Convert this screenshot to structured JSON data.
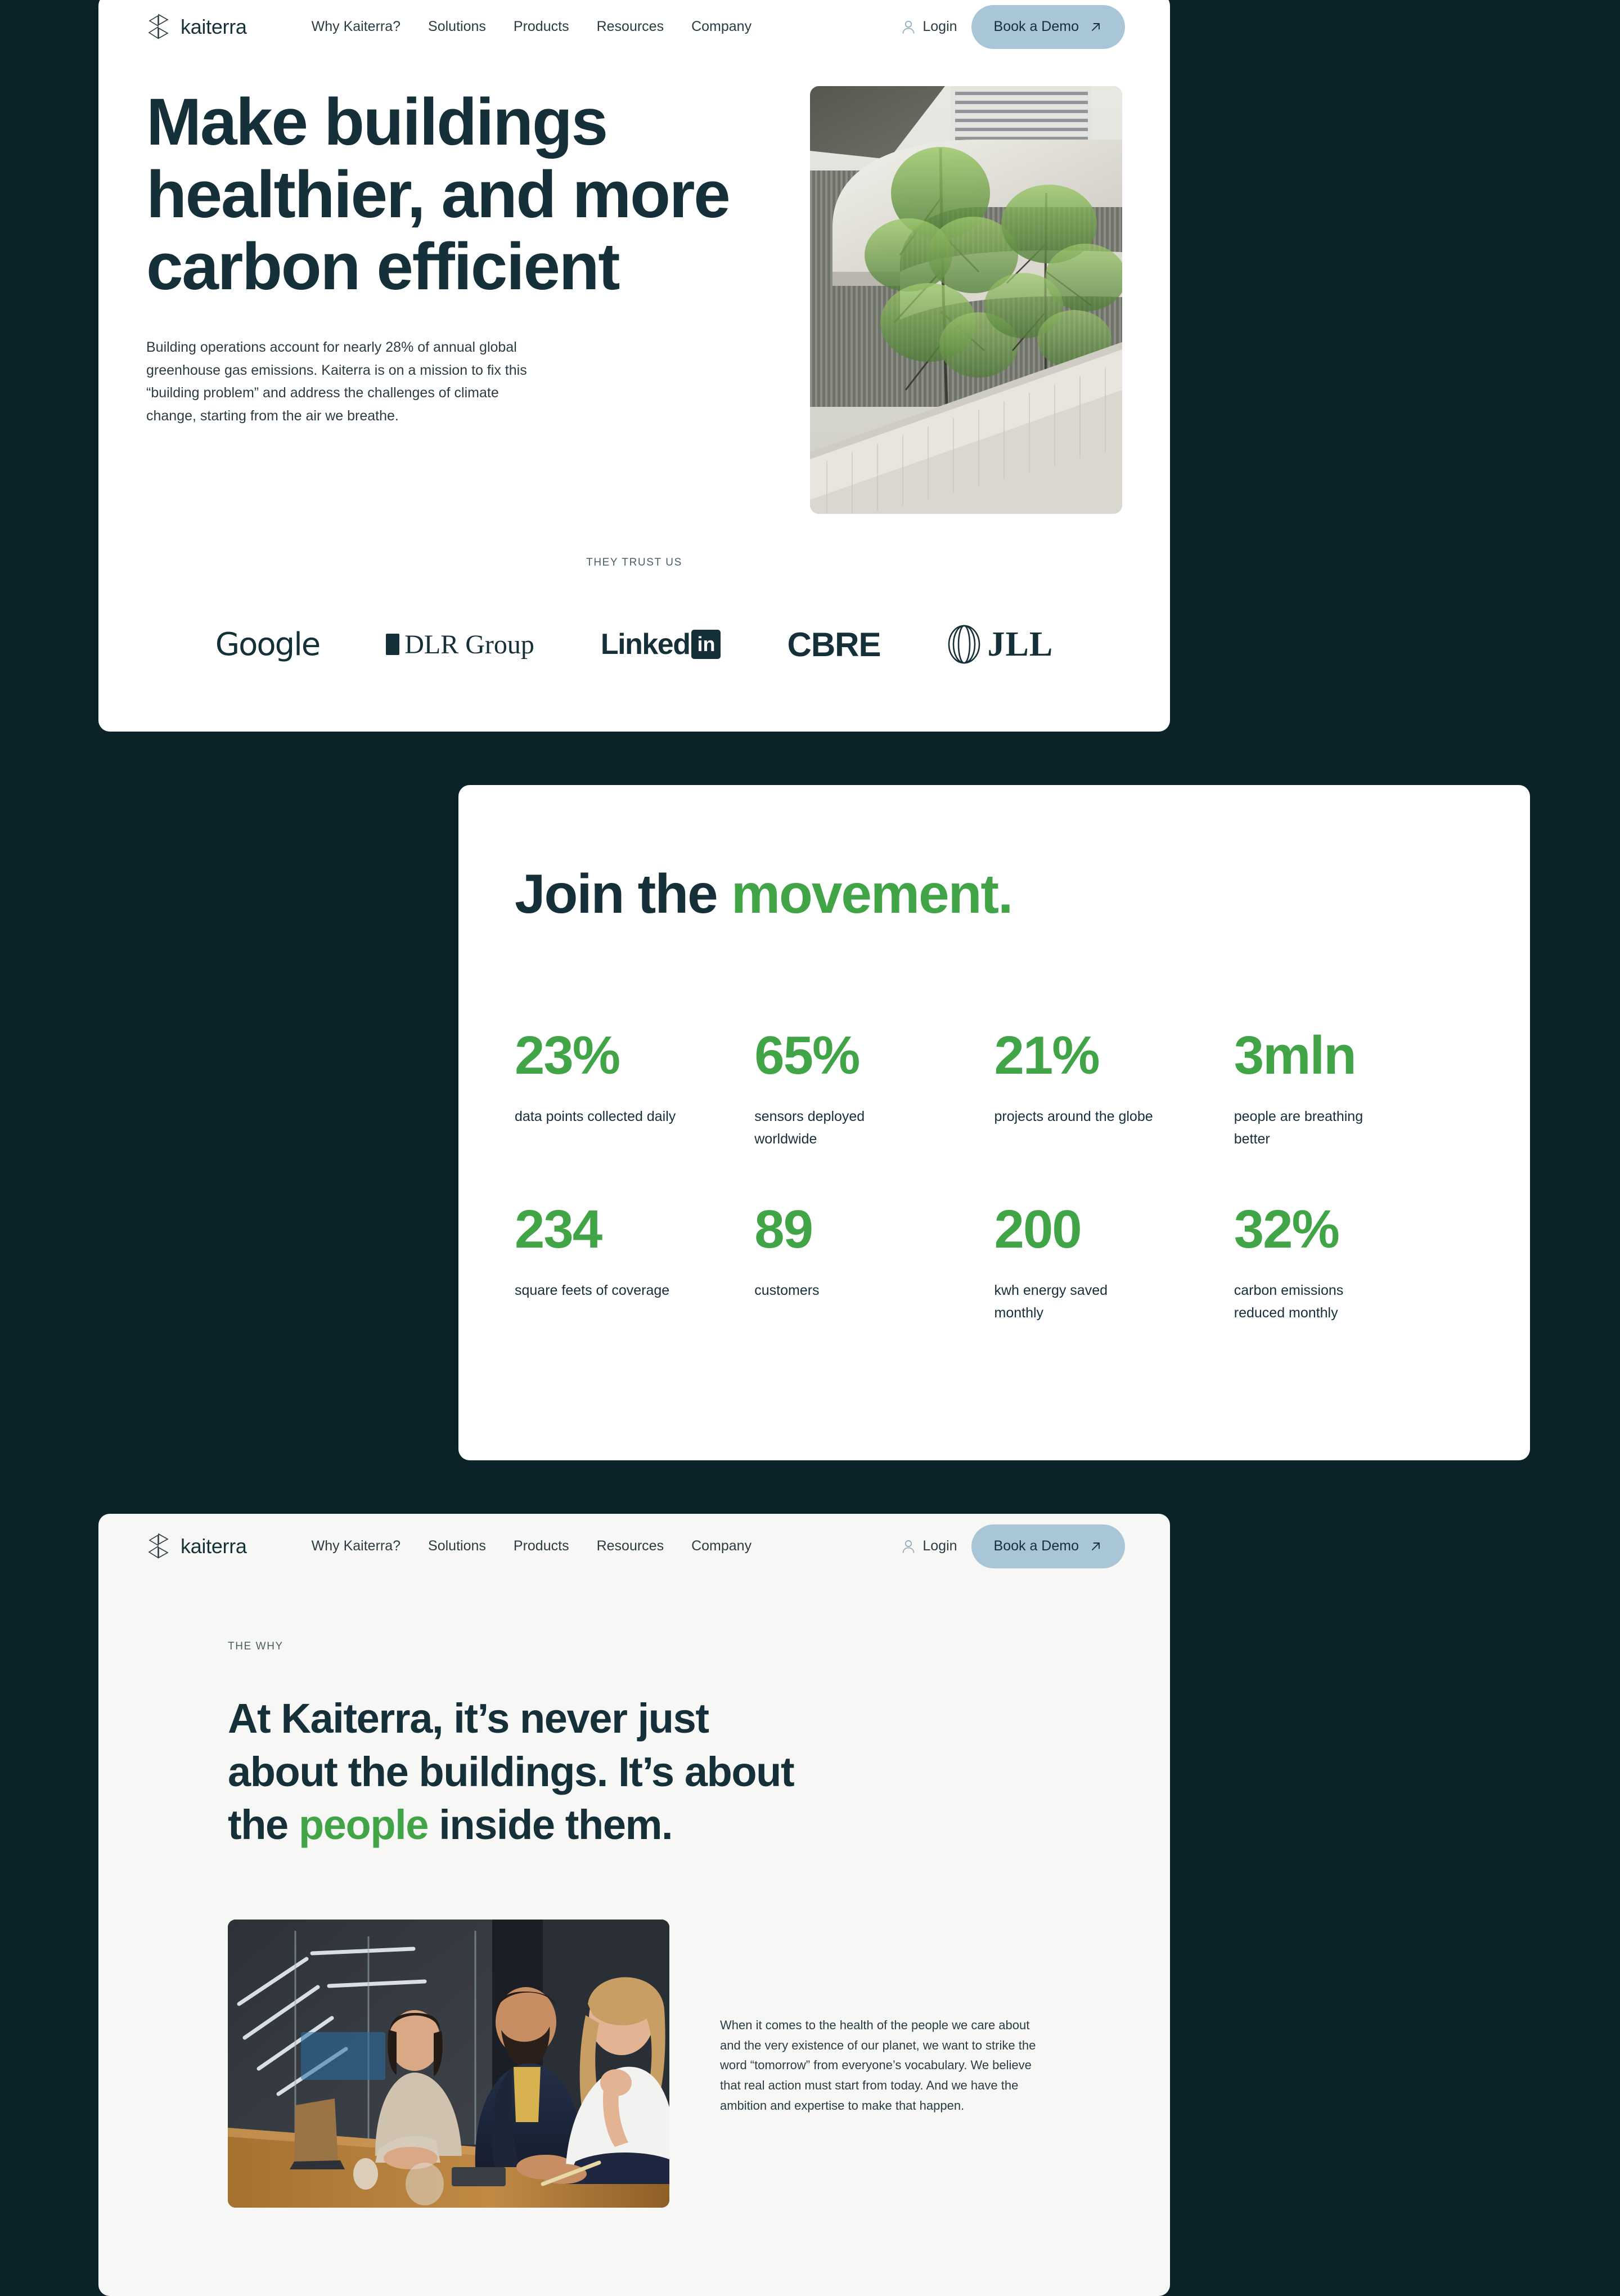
{
  "theme": {
    "page_background": "#0A2228",
    "card_background": "#FFFFFF",
    "card_background_alt": "#F7F7F6",
    "text_dark": "#16303A",
    "accent_green": "#41A548",
    "button_blue": "#A9C6D6"
  },
  "nav": {
    "brand": "kaiterra",
    "links": [
      "Why Kaiterra?",
      "Solutions",
      "Products",
      "Resources",
      "Company"
    ],
    "login_label": "Login",
    "demo_label": "Book a Demo"
  },
  "hero": {
    "title": "Make buildings healthier, and more carbon efficient",
    "paragraph": "Building operations account for nearly 28% of annual global greenhouse gas emissions. Kaiterra is on a mission to fix this “building problem” and address the challenges of climate change, starting from the air we breathe.",
    "image_alt": "architectural-walkway-with-trees-photo"
  },
  "trust": {
    "label": "THEY TRUST US",
    "logos": [
      {
        "name": "Google",
        "id": "google-logo"
      },
      {
        "name": "DLR Group",
        "id": "dlr-group-logo"
      },
      {
        "name": "Linked",
        "badge": "in",
        "id": "linkedin-logo"
      },
      {
        "name": "CBRE",
        "id": "cbre-logo"
      },
      {
        "name": "JLL",
        "id": "jll-logo"
      }
    ]
  },
  "stats_section": {
    "title_plain": "Join the ",
    "title_accent": "movement.",
    "items": [
      {
        "value": "23%",
        "label": "data points collected daily"
      },
      {
        "value": "65%",
        "label": "sensors deployed worldwide"
      },
      {
        "value": "21%",
        "label": "projects around the globe"
      },
      {
        "value": "3mln",
        "label": "people are breathing better"
      },
      {
        "value": "234",
        "label": "square feets of coverage"
      },
      {
        "value": "89",
        "label": "customers"
      },
      {
        "value": "200",
        "label": "kwh energy saved monthly"
      },
      {
        "value": "32%",
        "label": "carbon emissions reduced monthly"
      }
    ]
  },
  "why_section": {
    "eyebrow": "THE WHY",
    "title_part1": "At Kaiterra, it’s never just about the buildings. It’s about the ",
    "title_accent": "people",
    "title_part2": " inside them.",
    "paragraph": "When it comes to the health of the people we care about and the very existence of our planet, we want to strike the word “tomorrow” from everyone’s vocabulary. We believe that real action must start from today. And we have the ambition and  expertise to make that happen.",
    "image_alt": "three-colleagues-smiling-in-meeting-room-photo"
  }
}
